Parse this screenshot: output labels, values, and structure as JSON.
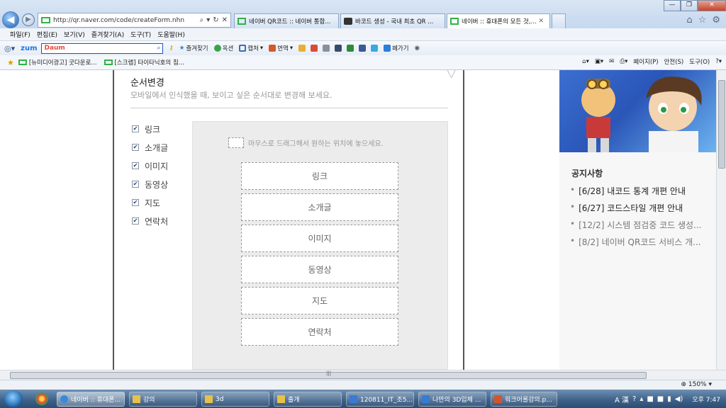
{
  "browser": {
    "address": "http://qr.naver.com/code/createForm.nhn",
    "tabs": [
      {
        "label": "네이버 QR코드 :: 네이버 통합...",
        "icon": "green",
        "active": false
      },
      {
        "label": "바코드 생성 - 국내 최초 QR ...",
        "icon": "dark",
        "active": false
      },
      {
        "label": "네이버 :: 휴대폰의 모든 것,...",
        "icon": "green",
        "active": true
      }
    ],
    "window_buttons": {
      "minimize": "—",
      "restore": "❐",
      "close": "✕"
    },
    "menu": [
      "파일(F)",
      "편집(E)",
      "보기(V)",
      "즐겨찾기(A)",
      "도구(T)",
      "도움말(H)"
    ],
    "toolbar": {
      "zum": "zum",
      "search_logo": "Daum",
      "favorites": "즐겨찾기",
      "okseon": "옥션",
      "capture": "캡처",
      "translate": "번역",
      "pagego": "페가기"
    },
    "favbar": [
      "[뉴미디어광고] 굿다운로...",
      "[스크랩] 타이타닉호의 침..."
    ],
    "cmdbar": [
      "페이지(P)",
      "안전(S)",
      "도구(O)"
    ],
    "zoom": "150%"
  },
  "dialog": {
    "title": "순서변경",
    "description": "모바일에서 인식했을 때, 보이고 싶은 순서대로 변경해 보세요.",
    "checkboxes": [
      {
        "label": "링크",
        "checked": true
      },
      {
        "label": "소개글",
        "checked": true
      },
      {
        "label": "이미지",
        "checked": true
      },
      {
        "label": "동영상",
        "checked": true
      },
      {
        "label": "지도",
        "checked": true
      },
      {
        "label": "연락처",
        "checked": true
      }
    ],
    "drag_hint": "마우스로 드래그해서 원하는 위치에 놓으세요.",
    "order_items": [
      "링크",
      "소개글",
      "이미지",
      "동영상",
      "지도",
      "연락처"
    ]
  },
  "sidebar": {
    "notice_title": "공지사항",
    "notices": [
      {
        "text": "[6/28] 내코드 통계 개편 안내",
        "new": true
      },
      {
        "text": "[6/27] 코드스타일 개편 안내",
        "new": true
      },
      {
        "text": "[12/2] 시스템 점검중 코드 생성...",
        "new": false
      },
      {
        "text": "[8/2] 네이버 QR코드 서비스 개...",
        "new": false
      }
    ]
  },
  "taskbar": {
    "tasks": [
      {
        "label": "네이버 :: 휴대폰...",
        "active": true
      },
      {
        "label": "강의",
        "active": false
      },
      {
        "label": "3d",
        "active": false
      },
      {
        "label": "출개",
        "active": false
      },
      {
        "label": "120811_IT_조5...",
        "active": false
      },
      {
        "label": "나만의 3D입체 ...",
        "active": false
      },
      {
        "label": "워크어롤강의.p...",
        "active": false
      }
    ],
    "ime": "A 漢",
    "clock": "오후 7:47"
  }
}
